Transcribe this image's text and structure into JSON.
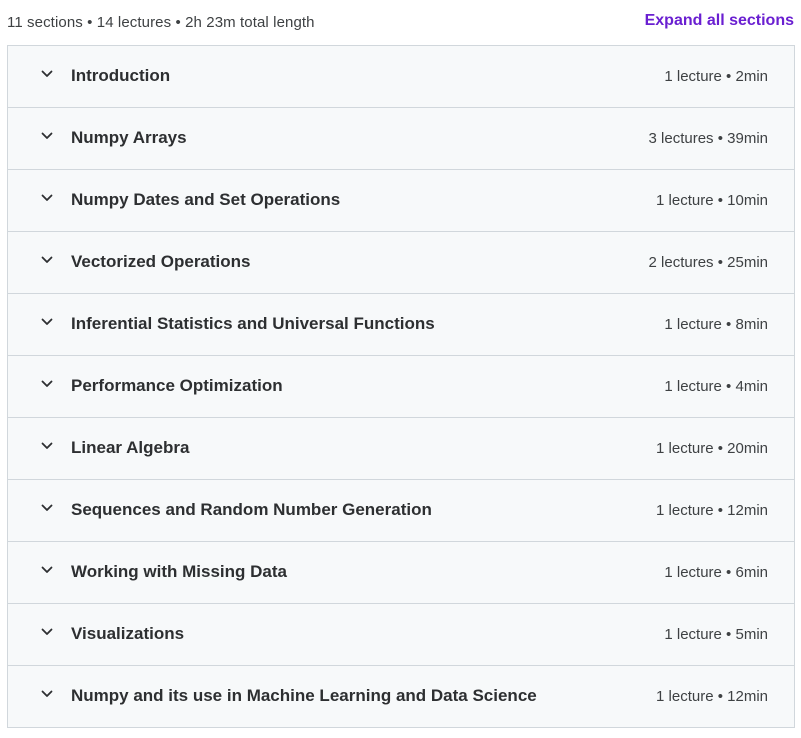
{
  "header": {
    "summary": "11 sections • 14 lectures • 2h 23m total length",
    "expand_all_label": "Expand all sections"
  },
  "colors": {
    "accent": "#6a1fd1",
    "section_bg": "#f7f9fa",
    "border": "#d1d7dc",
    "text": "#2d2f31"
  },
  "icons": {
    "section_toggle": "chevron-down-icon"
  },
  "sections": [
    {
      "title": "Introduction",
      "meta": "1 lecture • 2min"
    },
    {
      "title": "Numpy Arrays",
      "meta": "3 lectures • 39min"
    },
    {
      "title": "Numpy Dates and Set Operations",
      "meta": "1 lecture • 10min"
    },
    {
      "title": "Vectorized Operations",
      "meta": "2 lectures • 25min"
    },
    {
      "title": "Inferential Statistics and Universal Functions",
      "meta": "1 lecture • 8min"
    },
    {
      "title": "Performance Optimization",
      "meta": "1 lecture • 4min"
    },
    {
      "title": "Linear Algebra",
      "meta": "1 lecture • 20min"
    },
    {
      "title": "Sequences and Random Number Generation",
      "meta": "1 lecture • 12min"
    },
    {
      "title": "Working with Missing Data",
      "meta": "1 lecture • 6min"
    },
    {
      "title": "Visualizations",
      "meta": "1 lecture • 5min"
    },
    {
      "title": "Numpy and its use in Machine Learning and Data Science",
      "meta": "1 lecture • 12min"
    }
  ]
}
